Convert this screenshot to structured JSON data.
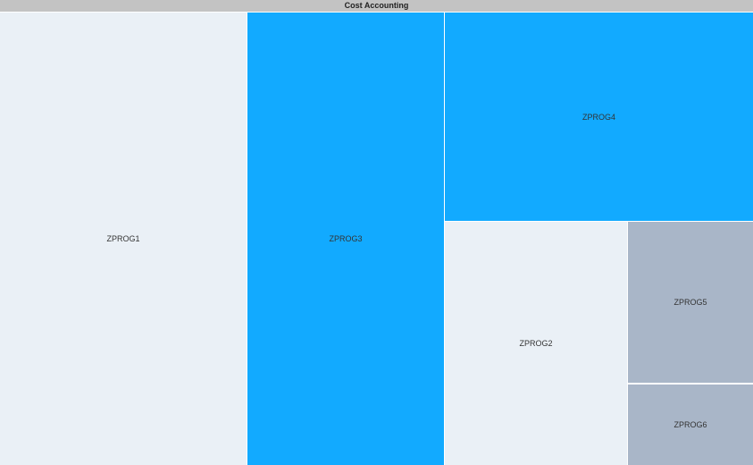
{
  "chart_data": {
    "type": "treemap",
    "title": "Cost Accounting",
    "cells": [
      {
        "label": "ZPROG1",
        "color": "#eaf0f6"
      },
      {
        "label": "ZPROG3",
        "color": "#12aaff"
      },
      {
        "label": "ZPROG4",
        "color": "#12aaff"
      },
      {
        "label": "ZPROG2",
        "color": "#eaf0f6"
      },
      {
        "label": "ZPROG5",
        "color": "#a9b6c8"
      },
      {
        "label": "ZPROG6",
        "color": "#a9b6c8"
      }
    ]
  }
}
